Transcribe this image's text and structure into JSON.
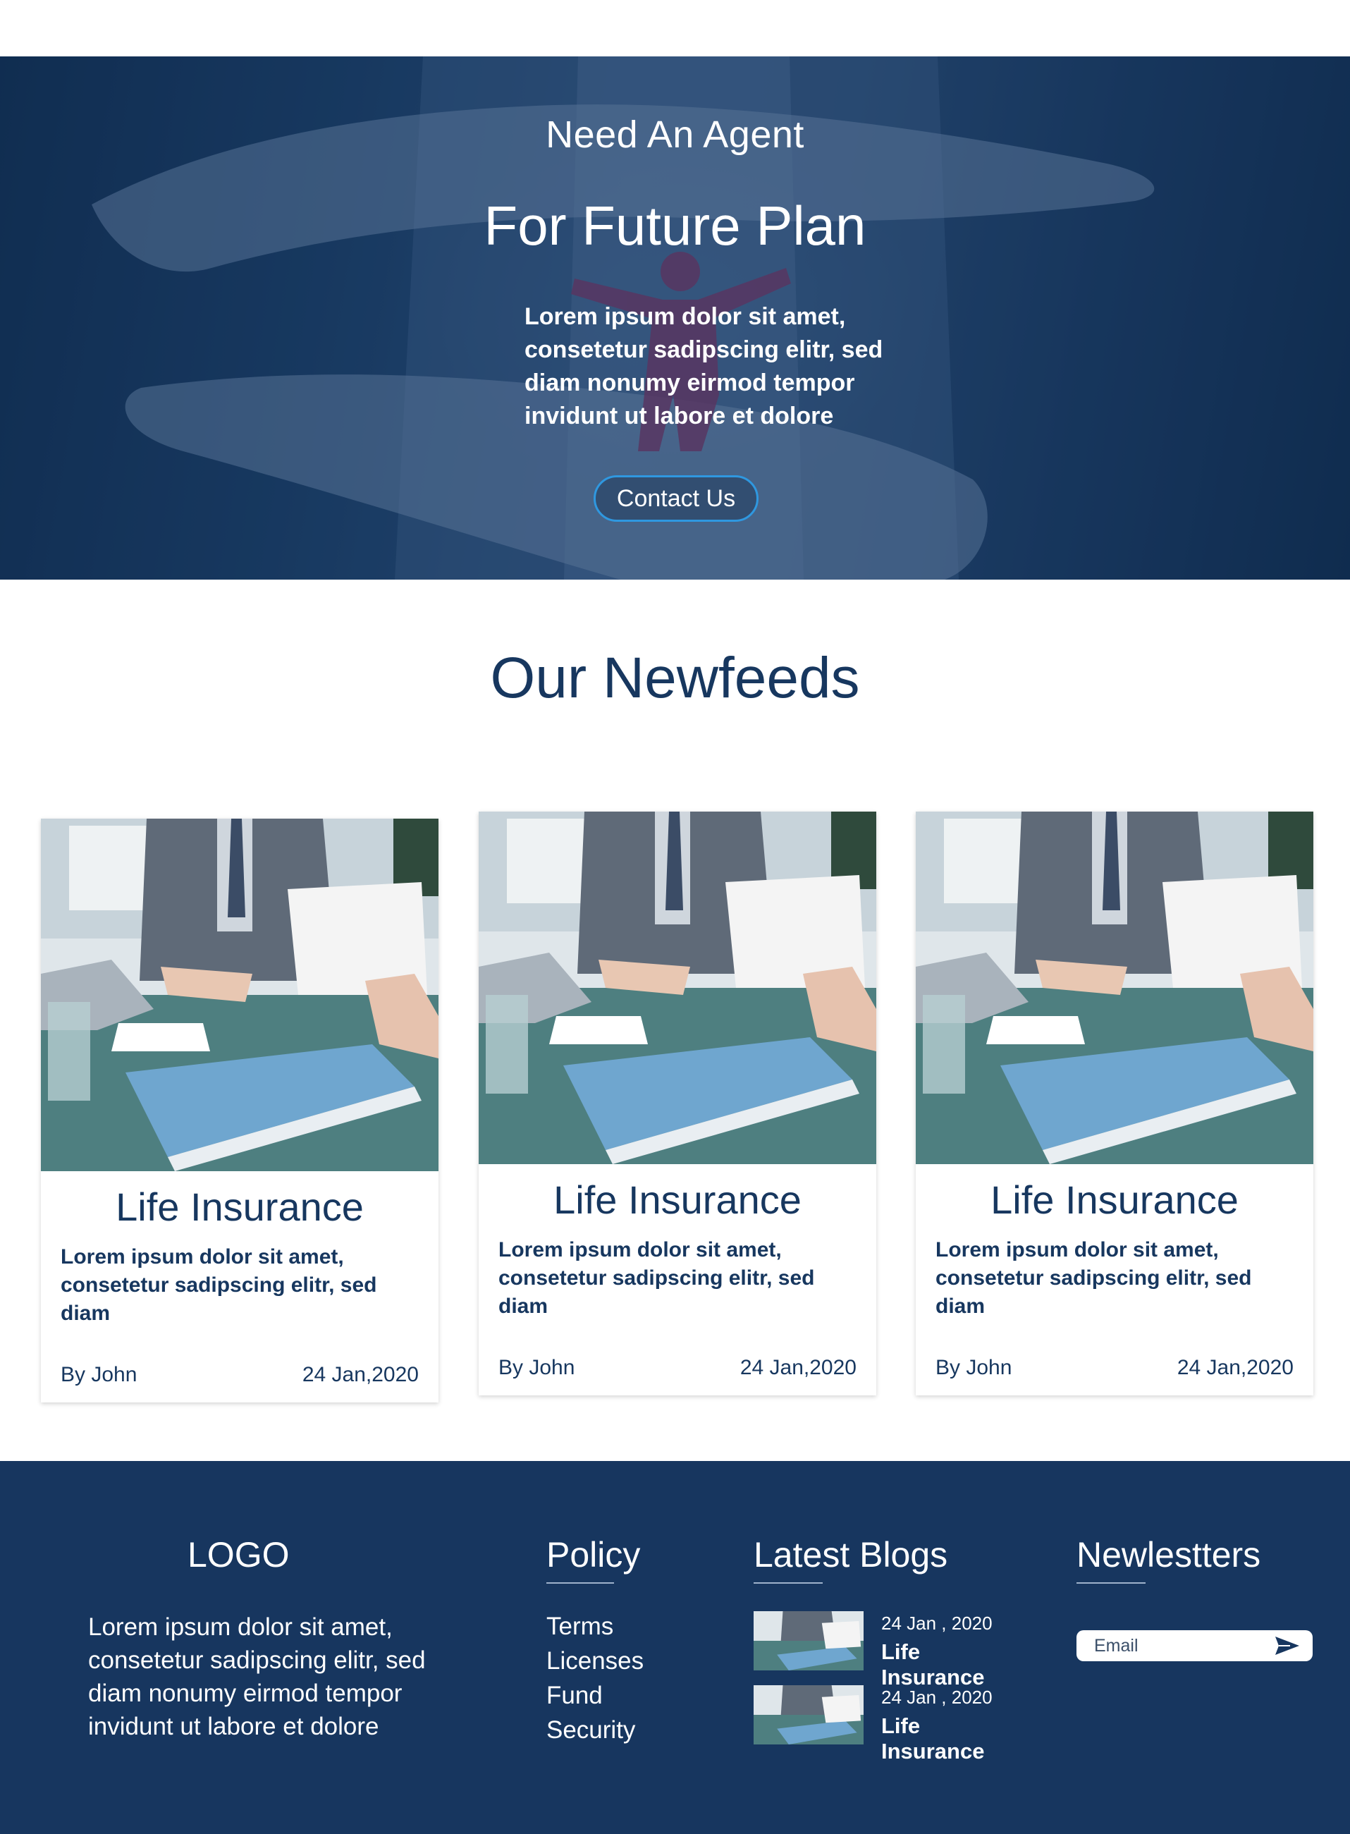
{
  "hero": {
    "subtitle": "Need An Agent",
    "title": "For Future Plan",
    "body": "Lorem ipsum dolor sit amet, consetetur sadipscing elitr, sed diam nonumy eirmod tempor invidunt ut labore et dolore",
    "button_label": "Contact Us"
  },
  "newsfeed": {
    "title": "Our Newfeeds",
    "cards": [
      {
        "title": "Life Insurance",
        "text": "Lorem ipsum dolor sit amet, consetetur sadipscing elitr, sed diam",
        "author": "By John",
        "date": "24 Jan,2020"
      },
      {
        "title": "Life Insurance",
        "text": "Lorem ipsum dolor sit amet, consetetur sadipscing elitr, sed diam",
        "author": "By John",
        "date": "24 Jan,2020"
      },
      {
        "title": "Life Insurance",
        "text": "Lorem ipsum dolor sit amet, consetetur sadipscing elitr, sed diam",
        "author": "By John",
        "date": "24 Jan,2020"
      }
    ]
  },
  "footer": {
    "logo": "LOGO",
    "about": "Lorem ipsum dolor sit amet, consetetur sadipscing elitr, sed diam nonumy eirmod tempor invidunt ut labore et dolore",
    "policy_heading": "Policy",
    "policy_links": [
      "Terms",
      "Licenses",
      "Fund",
      "Security"
    ],
    "blogs_heading": "Latest Blogs",
    "blogs": [
      {
        "date": "24 Jan , 2020",
        "title": "Life Insurance"
      },
      {
        "date": "24 Jan , 2020",
        "title": "Life Insurance"
      }
    ],
    "newsletter_heading": "Newlestters",
    "email_placeholder": "Email"
  },
  "colors": {
    "primary": "#17365f",
    "button_border": "#2f98e0",
    "text_dark": "#17375f"
  },
  "icons": [
    "send-icon"
  ]
}
